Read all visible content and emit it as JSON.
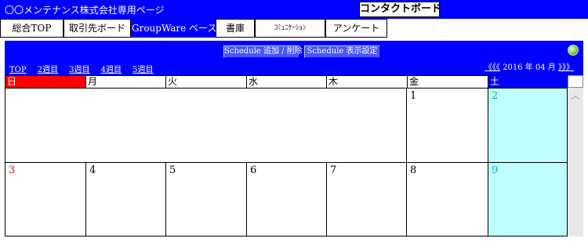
{
  "header": {
    "company": "〇〇メンテナンス株式会社専用ページ",
    "contact_board": "コンタクトボード"
  },
  "tabs": [
    {
      "label": "総合TOP"
    },
    {
      "label": "取引先ボード"
    },
    {
      "label": "GroupWare ベース",
      "active": true
    },
    {
      "label": "書庫"
    },
    {
      "label": "ｺﾐｭﾆｹｰｼｮﾝ"
    },
    {
      "label": "アンケート"
    }
  ],
  "toolbar": {
    "add_delete": "Schedule 追加 / 削除",
    "display_settings": "Schedule 表示設定",
    "status_icon": "green-dot-icon"
  },
  "weeknav": [
    "TOP",
    "2週目",
    "3週目",
    "4週目",
    "5週目"
  ],
  "monthnav": {
    "prev": "《《《",
    "month": "2016 年 04 月",
    "next": "》》》"
  },
  "calendar": {
    "weekdays": [
      "日",
      "月",
      "火",
      "水",
      "木",
      "金",
      "土"
    ],
    "colors": {
      "sunday": "#ff0000",
      "saturday_header": "#0000ff",
      "saturday_cell": "#c0ffff",
      "accent": "#0000ff"
    },
    "week1": [
      "",
      "",
      "",
      "",
      "",
      "1",
      "2"
    ],
    "week2": [
      "3",
      "4",
      "5",
      "6",
      "7",
      "8",
      "9"
    ]
  },
  "scrollbar": {
    "up_icon": "chevron-up-icon"
  }
}
